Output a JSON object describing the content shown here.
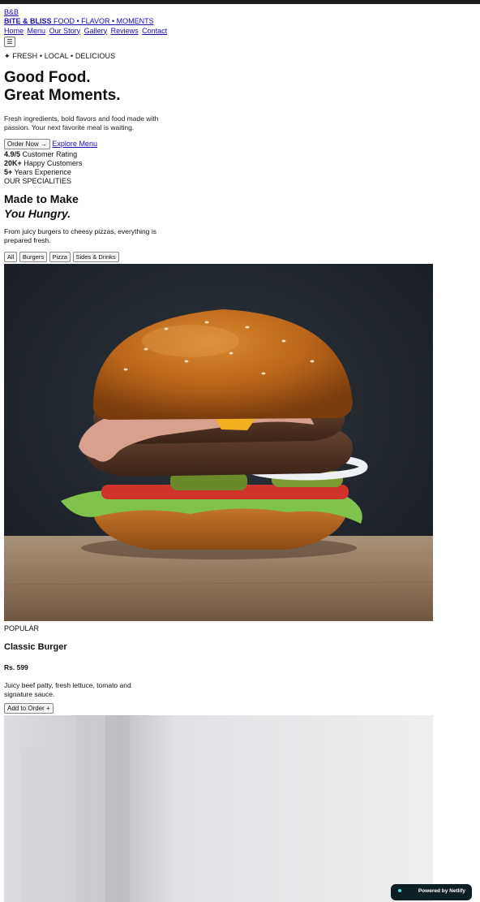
{
  "brand": {
    "logo_text": "B&B",
    "name": "BITE & BLISS",
    "tagline": "FOOD • FLAVOR • MOMENTS"
  },
  "nav": {
    "items": [
      "Home",
      "Menu",
      "Our Story",
      "Gallery",
      "Reviews",
      "Contact"
    ],
    "menu_icon": "☰"
  },
  "hero": {
    "eyebrow": "✦ FRESH • LOCAL • DELICIOUS",
    "title_line1": "Good Food.",
    "title_line2": "Great Moments.",
    "lead": "Fresh ingredients, bold flavors and food made with passion. Your next favorite meal is waiting.",
    "cta_primary": "Order Now →",
    "cta_secondary": "Explore Menu",
    "stats": [
      {
        "value": "4.9/5",
        "label": "Customer Rating"
      },
      {
        "value": "20K+",
        "label": "Happy Customers"
      },
      {
        "value": "5+",
        "label": "Years Experience"
      }
    ]
  },
  "specialities": {
    "label": "OUR SPECIALITIES",
    "title_line1": "Made to Make",
    "title_line2": "You Hungry.",
    "lead": "From juicy burgers to cheesy pizzas, everything is prepared fresh.",
    "filters": [
      "All",
      "Burgers",
      "Pizza",
      "Sides & Drinks"
    ]
  },
  "menu_items": [
    {
      "tag": "POPULAR",
      "name": "Classic Burger",
      "price": "Rs. 599",
      "description": "Juicy beef patty, fresh lettuce, tomato and signature sauce.",
      "button": "Add to Order +"
    }
  ],
  "footer_badge": {
    "text": "Powered by Netlify"
  }
}
